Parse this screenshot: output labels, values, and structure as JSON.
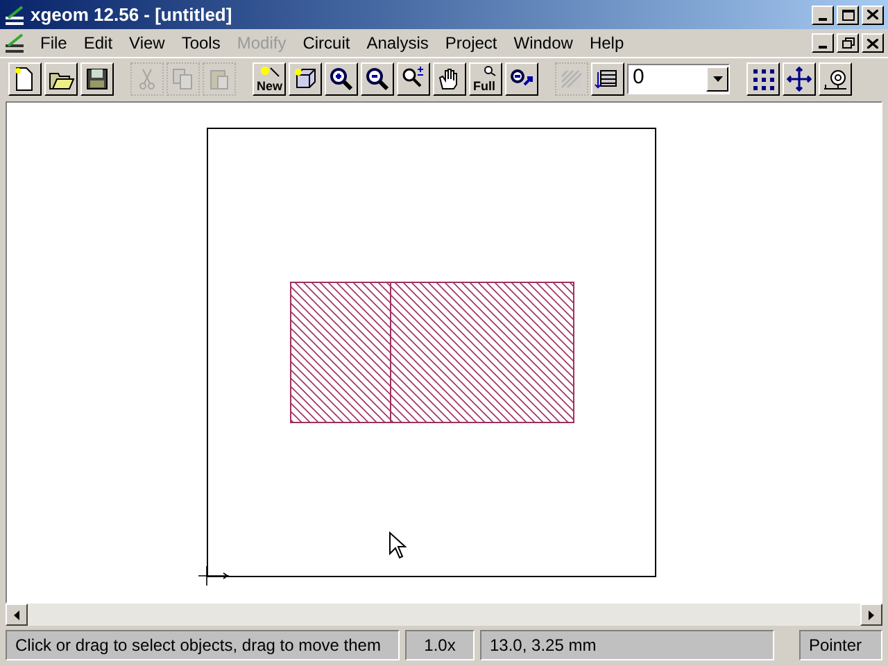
{
  "window": {
    "title": "xgeom 12.56 - [untitled]"
  },
  "menu": [
    {
      "label": "File",
      "disabled": false
    },
    {
      "label": "Edit",
      "disabled": false
    },
    {
      "label": "View",
      "disabled": false
    },
    {
      "label": "Tools",
      "disabled": false
    },
    {
      "label": "Modify",
      "disabled": true
    },
    {
      "label": "Circuit",
      "disabled": false
    },
    {
      "label": "Analysis",
      "disabled": false
    },
    {
      "label": "Project",
      "disabled": false
    },
    {
      "label": "Window",
      "disabled": false
    },
    {
      "label": "Help",
      "disabled": false
    }
  ],
  "toolbar": [
    {
      "kind": "button",
      "disabled": false
    },
    {
      "kind": "button",
      "disabled": false
    },
    {
      "kind": "button",
      "disabled": false
    },
    {
      "kind": "gap"
    },
    {
      "kind": "button",
      "disabled": true
    },
    {
      "kind": "button",
      "disabled": true
    },
    {
      "kind": "button",
      "disabled": true
    },
    {
      "kind": "gap"
    },
    {
      "kind": "button",
      "label": "New",
      "disabled": false
    },
    {
      "kind": "button",
      "disabled": false
    },
    {
      "kind": "button",
      "disabled": false
    },
    {
      "kind": "button",
      "disabled": false
    },
    {
      "kind": "button",
      "disabled": false
    },
    {
      "kind": "button",
      "disabled": false
    },
    {
      "kind": "button",
      "label": "Full",
      "disabled": false
    },
    {
      "kind": "button",
      "disabled": false
    },
    {
      "kind": "gap"
    },
    {
      "kind": "button",
      "disabled": true
    },
    {
      "kind": "button",
      "disabled": false
    },
    {
      "kind": "combo",
      "value": "0"
    },
    {
      "kind": "gap"
    },
    {
      "kind": "button",
      "disabled": false
    },
    {
      "kind": "button",
      "disabled": false
    },
    {
      "kind": "button",
      "disabled": false
    }
  ],
  "status_bar": [
    "Click or drag to select objects, drag to move them",
    "1.0x",
    "13.0, 3.25 mm",
    "Pointer"
  ]
}
